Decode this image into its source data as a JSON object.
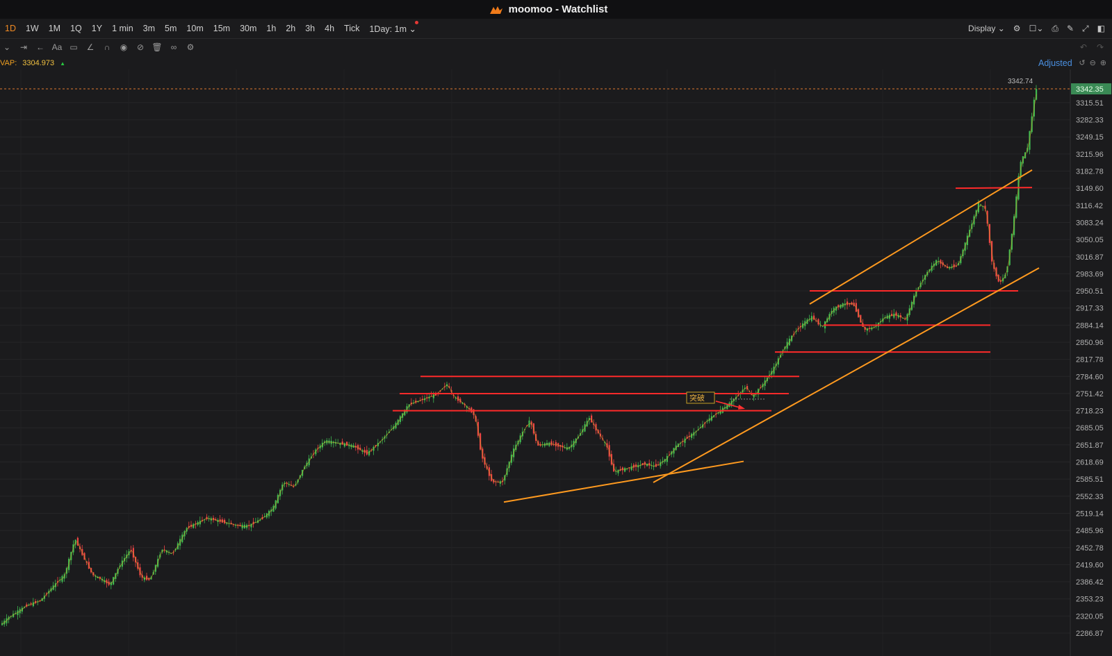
{
  "window": {
    "title": "moomoo - Watchlist"
  },
  "timeframes": [
    "1D",
    "1W",
    "1M",
    "1Q",
    "1Y",
    "1 min",
    "3m",
    "5m",
    "10m",
    "15m",
    "30m",
    "1h",
    "2h",
    "3h",
    "4h",
    "Tick"
  ],
  "active_timeframe": "1D",
  "day_selector": "1Day: 1m",
  "toolbar": {
    "display_label": "Display",
    "tools": [
      "crosshair-icon",
      "measure-icon",
      "arrow-icon",
      "text-icon",
      "comment-icon",
      "line-icon",
      "magnet-icon",
      "eye-icon",
      "hide-icon",
      "trash-icon",
      "link-icon",
      "settings-icon"
    ],
    "right_icons": [
      "settings-icon",
      "layout-icon",
      "camera-icon",
      "pen-icon",
      "fullscreen-icon",
      "panel-icon"
    ]
  },
  "indicator": {
    "name": "VAP:",
    "value": "3304.973",
    "trend": "up"
  },
  "adjusted_label": "Adjusted",
  "price_labels": {
    "current": "3342.35",
    "high": "3342.74"
  },
  "annotation_text": "突破",
  "colors": {
    "accent": "#f08a24",
    "up": "#3fb950",
    "down": "#ef4444",
    "hline": "#ff2a2a",
    "trend": "#ff9a1f",
    "ma": "#c9a227"
  },
  "chart_data": {
    "type": "candlestick",
    "y_ticks": [
      "3315.51",
      "3282.33",
      "3249.15",
      "3215.96",
      "3182.78",
      "3149.60",
      "3116.42",
      "3083.24",
      "3050.05",
      "3016.87",
      "2983.69",
      "2950.51",
      "2917.33",
      "2884.14",
      "2850.96",
      "2817.78",
      "2784.60",
      "2751.42",
      "2718.23",
      "2685.05",
      "2651.87",
      "2618.69",
      "2585.51",
      "2552.33",
      "2519.14",
      "2485.96",
      "2452.78",
      "2419.60",
      "2386.42",
      "2353.23",
      "2320.05",
      "2286.87"
    ],
    "ylim": [
      2286.87,
      3342.35
    ],
    "price_path": [
      [
        0,
        2300
      ],
      [
        15,
        2318
      ],
      [
        40,
        2340
      ],
      [
        60,
        2350
      ],
      [
        80,
        2380
      ],
      [
        95,
        2400
      ],
      [
        110,
        2470
      ],
      [
        120,
        2440
      ],
      [
        135,
        2400
      ],
      [
        150,
        2390
      ],
      [
        160,
        2380
      ],
      [
        175,
        2420
      ],
      [
        190,
        2450
      ],
      [
        205,
        2395
      ],
      [
        218,
        2390
      ],
      [
        235,
        2450
      ],
      [
        250,
        2440
      ],
      [
        270,
        2490
      ],
      [
        285,
        2500
      ],
      [
        300,
        2510
      ],
      [
        315,
        2505
      ],
      [
        330,
        2500
      ],
      [
        345,
        2495
      ],
      [
        360,
        2495
      ],
      [
        380,
        2510
      ],
      [
        395,
        2530
      ],
      [
        410,
        2580
      ],
      [
        425,
        2570
      ],
      [
        440,
        2610
      ],
      [
        455,
        2640
      ],
      [
        470,
        2660
      ],
      [
        490,
        2655
      ],
      [
        510,
        2650
      ],
      [
        530,
        2635
      ],
      [
        550,
        2660
      ],
      [
        570,
        2690
      ],
      [
        590,
        2730
      ],
      [
        610,
        2740
      ],
      [
        630,
        2750
      ],
      [
        645,
        2770
      ],
      [
        655,
        2745
      ],
      [
        670,
        2730
      ],
      [
        685,
        2710
      ],
      [
        695,
        2630
      ],
      [
        710,
        2580
      ],
      [
        725,
        2580
      ],
      [
        740,
        2640
      ],
      [
        755,
        2680
      ],
      [
        765,
        2700
      ],
      [
        775,
        2650
      ],
      [
        790,
        2655
      ],
      [
        805,
        2650
      ],
      [
        820,
        2645
      ],
      [
        835,
        2670
      ],
      [
        850,
        2705
      ],
      [
        860,
        2680
      ],
      [
        875,
        2650
      ],
      [
        885,
        2600
      ],
      [
        900,
        2605
      ],
      [
        915,
        2610
      ],
      [
        930,
        2615
      ],
      [
        945,
        2610
      ],
      [
        960,
        2625
      ],
      [
        975,
        2650
      ],
      [
        990,
        2665
      ],
      [
        1005,
        2680
      ],
      [
        1020,
        2700
      ],
      [
        1035,
        2715
      ],
      [
        1050,
        2730
      ],
      [
        1065,
        2750
      ],
      [
        1075,
        2765
      ],
      [
        1085,
        2745
      ],
      [
        1100,
        2770
      ],
      [
        1115,
        2800
      ],
      [
        1130,
        2840
      ],
      [
        1145,
        2870
      ],
      [
        1160,
        2890
      ],
      [
        1170,
        2900
      ],
      [
        1185,
        2880
      ],
      [
        1200,
        2915
      ],
      [
        1215,
        2925
      ],
      [
        1230,
        2925
      ],
      [
        1245,
        2875
      ],
      [
        1260,
        2880
      ],
      [
        1275,
        2900
      ],
      [
        1290,
        2905
      ],
      [
        1305,
        2895
      ],
      [
        1320,
        2950
      ],
      [
        1335,
        2985
      ],
      [
        1350,
        3010
      ],
      [
        1365,
        2995
      ],
      [
        1380,
        3000
      ],
      [
        1395,
        3060
      ],
      [
        1410,
        3120
      ],
      [
        1420,
        3110
      ],
      [
        1430,
        3000
      ],
      [
        1440,
        2965
      ],
      [
        1450,
        2985
      ],
      [
        1460,
        3080
      ],
      [
        1470,
        3200
      ],
      [
        1480,
        3225
      ],
      [
        1488,
        3300
      ],
      [
        1492,
        3342.35
      ]
    ],
    "horizontal_lines": [
      {
        "from": [
          605,
          2784.6
        ],
        "to": [
          1150,
          2784.6
        ]
      },
      {
        "from": [
          575,
          2751.4
        ],
        "to": [
          1135,
          2751.4
        ]
      },
      {
        "from": [
          565,
          2718.2
        ],
        "to": [
          1110,
          2718.2
        ]
      },
      {
        "from": [
          1165,
          2950.5
        ],
        "to": [
          1465,
          2950.5
        ]
      },
      {
        "from": [
          1185,
          2884.1
        ],
        "to": [
          1425,
          2884.1
        ]
      },
      {
        "from": [
          1115,
          2832
        ],
        "to": [
          1425,
          2832
        ]
      },
      {
        "from": [
          1375,
          3149.6
        ],
        "to": [
          1485,
          3151
        ]
      }
    ],
    "trend_lines": [
      {
        "from": [
          725,
          2541
        ],
        "to": [
          1070,
          2620
        ]
      },
      {
        "from": [
          940,
          2579
        ],
        "to": [
          1495,
          2995
        ]
      },
      {
        "from": [
          1165,
          2925
        ],
        "to": [
          1485,
          3185
        ]
      }
    ]
  }
}
